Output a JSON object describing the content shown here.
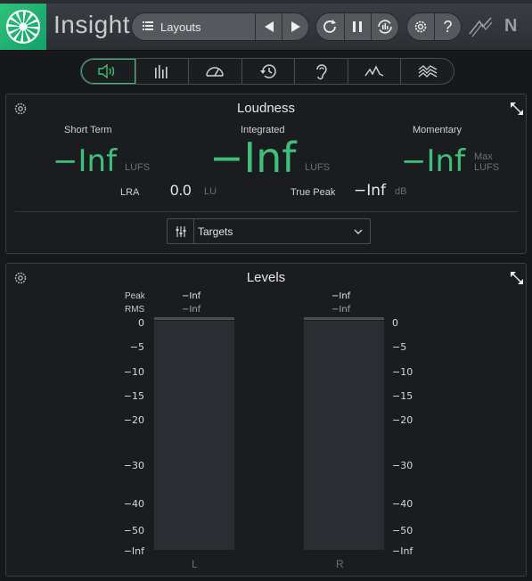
{
  "app": {
    "title": "Insight"
  },
  "header": {
    "layouts_label": "Layouts",
    "icons": [
      "menu-icon",
      "prev-arrow-icon",
      "next-arrow-icon",
      "loop-icon",
      "pause-icon",
      "reset-icon",
      "settings-gear-icon",
      "help-icon",
      "izotope-logo-icon",
      "native-instruments-logo-icon"
    ],
    "help_label": "?",
    "ni_label": "N"
  },
  "modes": [
    {
      "name": "loudness",
      "icon": "speaker-icon",
      "active": true
    },
    {
      "name": "levels",
      "icon": "level-bars-icon",
      "active": false
    },
    {
      "name": "meter",
      "icon": "gauge-icon",
      "active": false
    },
    {
      "name": "history",
      "icon": "history-icon",
      "active": false
    },
    {
      "name": "surround",
      "icon": "ear-icon",
      "active": false
    },
    {
      "name": "spectrum",
      "icon": "spectrum-icon",
      "active": false
    },
    {
      "name": "spectrogram",
      "icon": "spectrogram-icon",
      "active": false
    }
  ],
  "loudness": {
    "title": "Loudness",
    "short_term": {
      "label": "Short Term",
      "value": "−Inf",
      "unit": "LUFS"
    },
    "integrated": {
      "label": "Integrated",
      "value": "−Inf",
      "unit": "LUFS"
    },
    "momentary": {
      "label": "Momentary",
      "value": "−Inf",
      "unit_line1": "Max",
      "unit_line2": "LUFS"
    },
    "lra": {
      "label": "LRA",
      "value": "0.0",
      "unit": "LU"
    },
    "true_peak": {
      "label": "True Peak",
      "value": "−Inf",
      "unit": "dB"
    },
    "targets": {
      "label": "Targets"
    },
    "accent_color": "#3ec07a"
  },
  "levels": {
    "title": "Levels",
    "peak_label": "Peak",
    "rms_label": "RMS",
    "channels": [
      {
        "name": "L",
        "peak": "−Inf",
        "rms": "−Inf"
      },
      {
        "name": "R",
        "peak": "−Inf",
        "rms": "−Inf"
      }
    ],
    "scale": [
      "0",
      "−5",
      "−10",
      "−15",
      "−20",
      "−30",
      "−40",
      "−50",
      "−Inf"
    ]
  }
}
